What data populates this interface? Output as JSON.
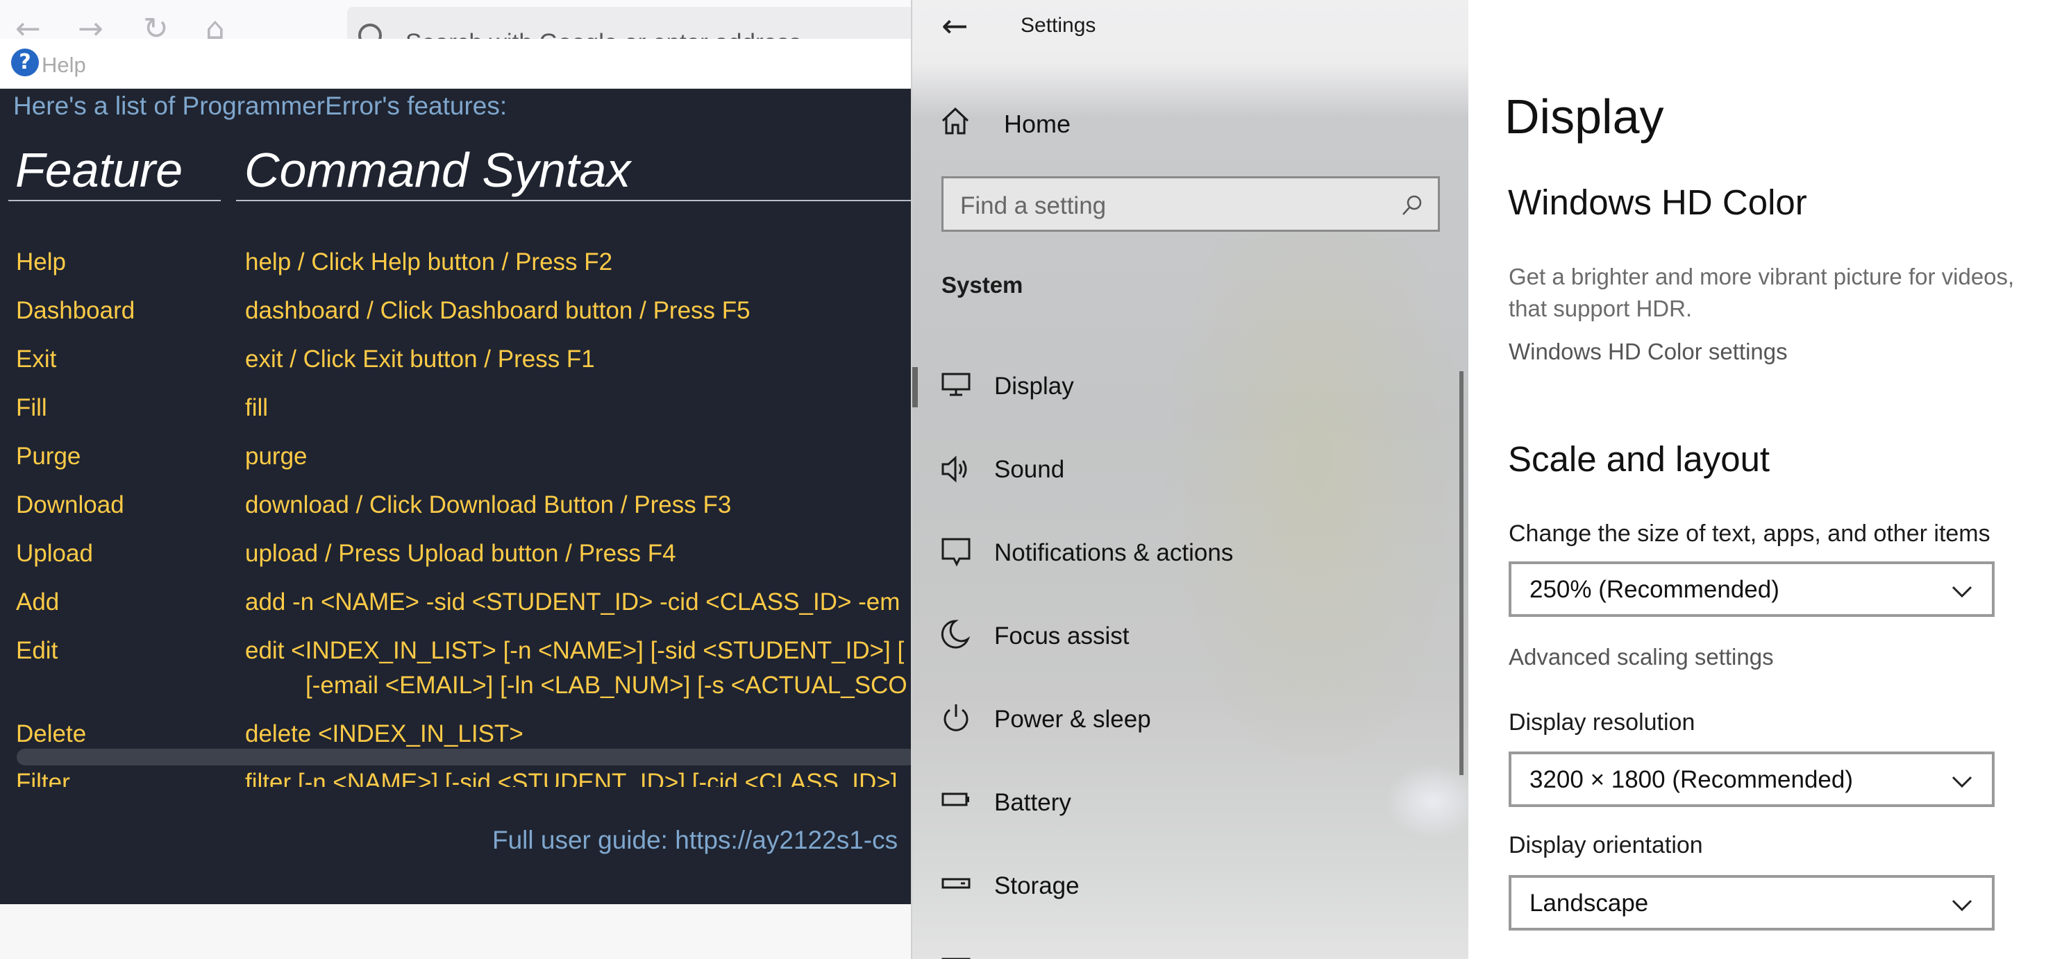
{
  "browser": {
    "address_placeholder": "Search with Google or enter address"
  },
  "help": {
    "title": "Help",
    "intro": "Here's a list of ProgrammerError's features:",
    "columns": {
      "feature": "Feature",
      "syntax": "Command Syntax"
    },
    "rows": [
      {
        "feature": "Help",
        "syntax": "help / Click Help button / Press F2"
      },
      {
        "feature": "Dashboard",
        "syntax": "dashboard / Click Dashboard button / Press F5"
      },
      {
        "feature": "Exit",
        "syntax": "exit / Click Exit button / Press F1"
      },
      {
        "feature": "Fill",
        "syntax": "fill"
      },
      {
        "feature": "Purge",
        "syntax": "purge"
      },
      {
        "feature": "Download",
        "syntax": "download / Click Download Button / Press F3"
      },
      {
        "feature": "Upload",
        "syntax": "upload / Press Upload button / Press F4"
      },
      {
        "feature": "Add",
        "syntax": "add  -n <NAME>  -sid <STUDENT_ID>  -cid <CLASS_ID>  -em"
      },
      {
        "feature": "Edit",
        "syntax": "edit  <INDEX_IN_LIST>  [-n <NAME>]  [-sid <STUDENT_ID>]  [",
        "syntax_line2": "[-email <EMAIL>]  [-ln <LAB_NUM>]  [-s <ACTUAL_SCO"
      },
      {
        "feature": "Delete",
        "syntax": "delete  <INDEX_IN_LIST>"
      },
      {
        "feature": "Filter",
        "syntax": "filter  [-n <NAME>]  [-sid <STUDENT_ID>]  [-cid <CLASS_ID>]"
      }
    ],
    "guide": "Full user guide: https://ay2122s1-cs"
  },
  "settings": {
    "title": "Settings",
    "home_label": "Home",
    "search_placeholder": "Find a setting",
    "section": "System",
    "nav_items": [
      {
        "label": "Display",
        "icon": "monitor-icon",
        "selected": true
      },
      {
        "label": "Sound",
        "icon": "speaker-icon",
        "selected": false
      },
      {
        "label": "Notifications & actions",
        "icon": "notification-icon",
        "selected": false
      },
      {
        "label": "Focus assist",
        "icon": "moon-icon",
        "selected": false
      },
      {
        "label": "Power & sleep",
        "icon": "power-icon",
        "selected": false
      },
      {
        "label": "Battery",
        "icon": "battery-icon",
        "selected": false
      },
      {
        "label": "Storage",
        "icon": "storage-icon",
        "selected": false
      }
    ]
  },
  "display": {
    "page_title": "Display",
    "hdr": {
      "heading": "Windows HD Color",
      "description_line1": "Get a brighter and more vibrant picture for videos,",
      "description_line2": "that support HDR.",
      "link": "Windows HD Color settings"
    },
    "scale": {
      "heading": "Scale and layout",
      "size_label": "Change the size of text, apps, and other items",
      "size_value": "250% (Recommended)",
      "advanced_link": "Advanced scaling settings",
      "resolution_label": "Display resolution",
      "resolution_value": "3200 × 1800 (Recommended)",
      "orientation_label": "Display orientation",
      "orientation_value": "Landscape"
    }
  },
  "colors": {
    "help_bg": "#1f2430",
    "help_accent_text": "#ffcb47",
    "help_info_text": "#7fa7ce",
    "settings_text": "#111111"
  }
}
